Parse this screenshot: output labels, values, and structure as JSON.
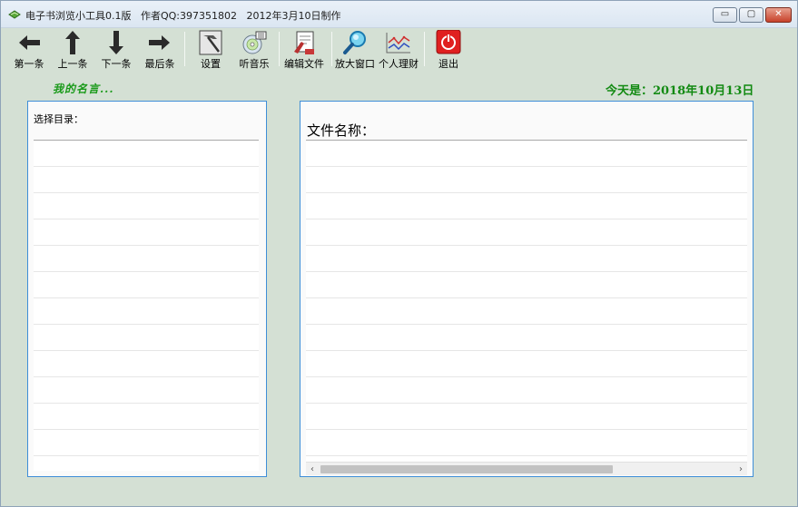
{
  "window": {
    "title": "电子书浏览小工具0.1版   作者QQ:397351802   2012年3月10日制作",
    "controls": {
      "minimize": "▭",
      "maximize": "▢",
      "close": "✕"
    }
  },
  "toolbar": {
    "items": [
      {
        "id": "first",
        "label": "第一条",
        "icon": "arrow-left-icon"
      },
      {
        "id": "prev",
        "label": "上一条",
        "icon": "arrow-up-icon"
      },
      {
        "id": "next",
        "label": "下一条",
        "icon": "arrow-down-icon"
      },
      {
        "id": "last",
        "label": "最后条",
        "icon": "arrow-right-icon"
      },
      {
        "id": "settings",
        "label": "设置",
        "icon": "hammer-icon"
      },
      {
        "id": "music",
        "label": "听音乐",
        "icon": "cd-music-icon"
      },
      {
        "id": "edit",
        "label": "编辑文件",
        "icon": "edit-document-icon"
      },
      {
        "id": "zoom",
        "label": "放大窗口",
        "icon": "magnifier-icon"
      },
      {
        "id": "finance",
        "label": "个人理财",
        "icon": "line-chart-icon"
      },
      {
        "id": "exit",
        "label": "退出",
        "icon": "power-icon"
      }
    ]
  },
  "motto": "我的名言...",
  "today": "今天是：2018年10月13日",
  "left_panel": {
    "label": "选择目录："
  },
  "right_panel": {
    "label": "文件名称：",
    "scrollbar": {
      "left": "‹",
      "right": "›"
    }
  },
  "colors": {
    "background": "#d4e0d4",
    "panel_border": "#3f8ed8",
    "accent_green": "#128a12"
  }
}
